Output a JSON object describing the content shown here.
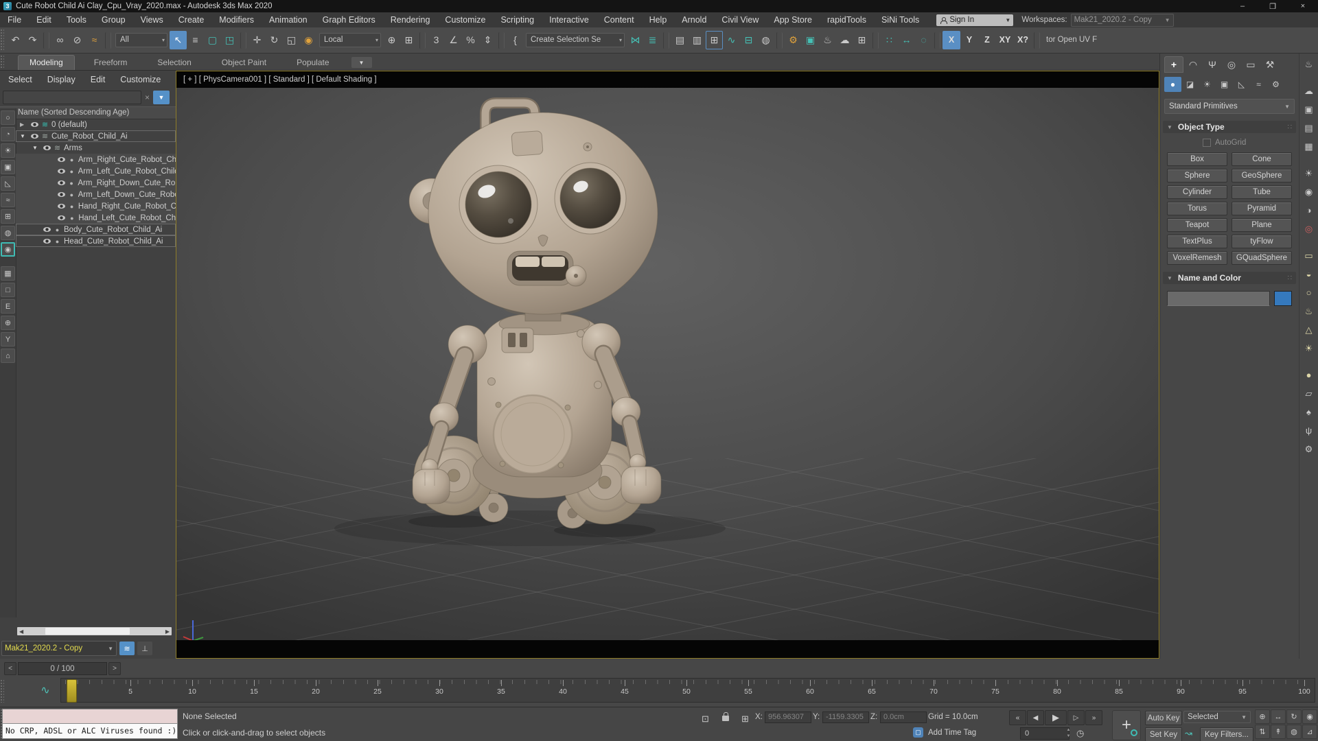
{
  "titlebar": {
    "app_icon": "3",
    "title": "Cute Robot Child Ai Clay_Cpu_Vray_2020.max - Autodesk 3ds Max 2020",
    "minimize": "–",
    "maximize": "❐",
    "close": "×"
  },
  "menubar": {
    "items": [
      "File",
      "Edit",
      "Tools",
      "Group",
      "Views",
      "Create",
      "Modifiers",
      "Animation",
      "Graph Editors",
      "Rendering",
      "Customize",
      "Scripting",
      "Interactive",
      "Content",
      "Help",
      "Arnold",
      "Civil View",
      "App Store",
      "rapidTools",
      "SiNi Tools"
    ],
    "sign_in_label": "Sign In",
    "workspaces_label": "Workspaces:",
    "workspace_value": "Mak21_2020.2  - Copy"
  },
  "toolbar": {
    "items": [
      {
        "name": "undo-icon",
        "glyph": "↶"
      },
      {
        "name": "redo-icon",
        "glyph": "↷"
      },
      {
        "name": "toolbar-separator",
        "cls": "sep"
      },
      {
        "name": "select-and-link-icon",
        "glyph": "∞"
      },
      {
        "name": "unlink-selection-icon",
        "glyph": "⊘"
      },
      {
        "name": "bind-to-space-warp-icon",
        "glyph": "≈",
        "cls": "orange"
      },
      {
        "name": "toolbar-separator",
        "cls": "sep"
      },
      {
        "name": "selection-filter-dropdown",
        "glyph": "All",
        "cls": "dd w52"
      },
      {
        "name": "select-object-icon",
        "glyph": "↖",
        "cls": "active"
      },
      {
        "name": "select-by-name-icon",
        "glyph": "≡"
      },
      {
        "name": "rectangular-selection-region-icon",
        "glyph": "▢",
        "cls": "teal"
      },
      {
        "name": "window-crossing-icon",
        "glyph": "◳",
        "cls": "teal"
      },
      {
        "name": "toolbar-separator",
        "cls": "sep"
      },
      {
        "name": "select-and-move-icon",
        "glyph": "✛"
      },
      {
        "name": "select-and-rotate-icon",
        "glyph": "↻"
      },
      {
        "name": "select-and-scale-icon",
        "glyph": "◱"
      },
      {
        "name": "select-and-place-icon",
        "glyph": "◉",
        "cls": "orange"
      },
      {
        "name": "reference-coordinate-dropdown",
        "glyph": "Local",
        "cls": "dd w66"
      },
      {
        "name": "use-pivot-point-icon",
        "glyph": "⊕"
      },
      {
        "name": "select-and-manipulate-icon",
        "glyph": "⊞"
      },
      {
        "name": "toolbar-separator",
        "cls": "sep"
      },
      {
        "name": "snaps-toggle-icon",
        "glyph": "3"
      },
      {
        "name": "angle-snap-icon",
        "glyph": "∠"
      },
      {
        "name": "percent-snap-icon",
        "glyph": "%"
      },
      {
        "name": "spinner-snap-icon",
        "glyph": "⇕"
      },
      {
        "name": "toolbar-separator",
        "cls": "sep"
      },
      {
        "name": "named-selection-sets-icon",
        "glyph": "{"
      },
      {
        "name": "selection-set-dropdown",
        "glyph": "Create Selection Se",
        "cls": "dd w120"
      },
      {
        "name": "mirror-icon",
        "glyph": "⋈",
        "cls": "teal"
      },
      {
        "name": "align-icon",
        "glyph": "≣",
        "cls": "teal"
      },
      {
        "name": "toolbar-separator",
        "cls": "sep"
      },
      {
        "name": "scene-explorer-toggle-icon",
        "glyph": "▤"
      },
      {
        "name": "layer-explorer-toggle-icon",
        "glyph": "▥"
      },
      {
        "name": "ribbon-toggle-icon",
        "glyph": "⊞",
        "cls": "framed"
      },
      {
        "name": "curve-editor-icon",
        "glyph": "∿",
        "cls": "teal"
      },
      {
        "name": "schematic-view-icon",
        "glyph": "⊟",
        "cls": "teal"
      },
      {
        "name": "material-editor-icon",
        "glyph": "◍"
      },
      {
        "name": "toolbar-separator",
        "cls": "sep"
      },
      {
        "name": "render-setup-icon",
        "glyph": "⚙",
        "cls": "orange"
      },
      {
        "name": "rendered-frame-window-icon",
        "glyph": "▣",
        "cls": "teal"
      },
      {
        "name": "render-production-icon",
        "glyph": "♨"
      },
      {
        "name": "render-in-cloud-icon",
        "glyph": "☁"
      },
      {
        "name": "render-presets-icon",
        "glyph": "⊞"
      },
      {
        "name": "toolbar-separator",
        "cls": "sep"
      },
      {
        "name": "snap-grid-icon",
        "glyph": "∷",
        "cls": "teal"
      },
      {
        "name": "measure-distance-icon",
        "glyph": "↔",
        "cls": "teal"
      },
      {
        "name": "soft-selection-icon",
        "glyph": "◌",
        "cls": "teal"
      },
      {
        "name": "toolbar-separator",
        "cls": "sep"
      },
      {
        "name": "axis-x-button",
        "glyph": "X",
        "cls": "axis active"
      },
      {
        "name": "axis-y-button",
        "glyph": "Y",
        "cls": "axis"
      },
      {
        "name": "axis-z-button",
        "glyph": "Z",
        "cls": "axis"
      },
      {
        "name": "axis-xy-button",
        "glyph": "XY",
        "cls": "axis"
      },
      {
        "name": "axis-xq-button",
        "glyph": "X?",
        "cls": "axis"
      },
      {
        "name": "toolbar-separator",
        "cls": "sep"
      },
      {
        "name": "docked-toolbar-label",
        "glyph": "tor Open UV F",
        "cls": "plain"
      }
    ]
  },
  "ribbon": {
    "tabs": [
      {
        "name": "tab-modeling",
        "label": "Modeling",
        "cls": "active"
      },
      {
        "name": "tab-freeform",
        "label": "Freeform"
      },
      {
        "name": "tab-selection",
        "label": "Selection"
      },
      {
        "name": "tab-object-paint",
        "label": "Object Paint"
      },
      {
        "name": "tab-populate",
        "label": "Populate"
      }
    ]
  },
  "scene_explorer": {
    "menus": [
      "Select",
      "Display",
      "Edit",
      "Customize"
    ],
    "search_value": "",
    "column_header": "Name (Sorted Descending Age)",
    "rows": [
      {
        "name": "tree-row-default-layer",
        "label": "0 (default)",
        "cls": "lvl0 closed layer teal-layer"
      },
      {
        "name": "tree-row-cute-robot-child",
        "label": "Cute_Robot_Child_Ai",
        "cls": "lvl0 open layer boxed"
      },
      {
        "name": "tree-row-arms",
        "label": "Arms",
        "cls": "lvl1 open layer"
      },
      {
        "name": "tree-row-arm-right",
        "label": "Arm_Right_Cute_Robot_Chi",
        "cls": "lvl2 leaf geom shaded"
      },
      {
        "name": "tree-row-arm-left",
        "label": "Arm_Left_Cute_Robot_Child",
        "cls": "lvl2 leaf geom shaded"
      },
      {
        "name": "tree-row-arm-right-down",
        "label": "Arm_Right_Down_Cute_Rob",
        "cls": "lvl2 leaf geom shaded"
      },
      {
        "name": "tree-row-arm-left-down",
        "label": "Arm_Left_Down_Cute_Robo",
        "cls": "lvl2 leaf geom shaded"
      },
      {
        "name": "tree-row-hand-right",
        "label": "Hand_Right_Cute_Robot_Cl",
        "cls": "lvl2 leaf geom shaded"
      },
      {
        "name": "tree-row-hand-left",
        "label": "Hand_Left_Cute_Robot_Chi",
        "cls": "lvl2 leaf geom shaded"
      },
      {
        "name": "tree-row-body",
        "label": "Body_Cute_Robot_Child_Ai",
        "cls": "lvl1 leaf geom boxed"
      },
      {
        "name": "tree-row-head",
        "label": "Head_Cute_Robot_Child_Ai",
        "cls": "lvl1 leaf geom boxed"
      }
    ],
    "left_strip": [
      {
        "name": "filter-selection-sets-icon",
        "glyph": "○"
      },
      {
        "name": "filter-geometry-icon",
        "glyph": "◔"
      },
      {
        "name": "filter-lights-icon",
        "glyph": "☀"
      },
      {
        "name": "filter-cameras-icon",
        "glyph": "▣"
      },
      {
        "name": "filter-helpers-icon",
        "glyph": "◺"
      },
      {
        "name": "filter-space-warps-icon",
        "glyph": "≈"
      },
      {
        "name": "filter-groups-icon",
        "glyph": "⊞"
      },
      {
        "name": "filter-xrefs-icon",
        "glyph": "◍"
      },
      {
        "name": "filter-objects-icon",
        "glyph": "◉",
        "cls": "on"
      },
      {
        "name": "filter-containers-icon",
        "glyph": "▦",
        "cls": "gap"
      },
      {
        "name": "filter-shapes-icon",
        "glyph": "□"
      },
      {
        "name": "filter-external-icon",
        "glyph": "E"
      },
      {
        "name": "filter-bones-icon",
        "glyph": "⊕"
      },
      {
        "name": "filter-y-icon",
        "glyph": "Y"
      },
      {
        "name": "filter-folder-icon",
        "glyph": "⌂"
      }
    ],
    "workspace_value": "Mak21_2020.2  - Copy"
  },
  "viewport": {
    "label": "[ + ] [ PhysCamera001 ] [ Standard ] [ Default Shading ]"
  },
  "command_panel": {
    "tabs": [
      {
        "name": "tab-create-icon",
        "glyph": "+",
        "cls": "active"
      },
      {
        "name": "tab-modify-icon",
        "glyph": "◠"
      },
      {
        "name": "tab-hierarchy-icon",
        "glyph": "Ψ"
      },
      {
        "name": "tab-motion-icon",
        "glyph": "◎"
      },
      {
        "name": "tab-display-icon",
        "glyph": "▭"
      },
      {
        "name": "tab-utilities-icon",
        "glyph": "⚒"
      }
    ],
    "categories": [
      {
        "name": "category-geometry-icon",
        "glyph": "●",
        "cls": "active"
      },
      {
        "name": "category-shapes-icon",
        "glyph": "◪"
      },
      {
        "name": "category-lights-icon",
        "glyph": "☀"
      },
      {
        "name": "category-cameras-icon",
        "glyph": "▣"
      },
      {
        "name": "category-helpers-icon",
        "glyph": "◺"
      },
      {
        "name": "category-space-warps-icon",
        "glyph": "≈"
      },
      {
        "name": "category-systems-icon",
        "glyph": "⚙"
      }
    ],
    "subcategory_dropdown": "Standard Primitives",
    "object_type_title": "Object Type",
    "autogrid_label": "AutoGrid",
    "object_buttons": [
      "Box",
      "Cone",
      "Sphere",
      "GeoSphere",
      "Cylinder",
      "Tube",
      "Torus",
      "Pyramid",
      "Teapot",
      "Plane",
      "TextPlus",
      "tyFlow",
      "VoxelRemesh",
      "GQuadSphere"
    ],
    "name_color_title": "Name and Color"
  },
  "right_strip": {
    "items": [
      {
        "name": "render-production-icon",
        "glyph": "♨"
      },
      {
        "name": "render-in-cloud-icon",
        "glyph": "☁",
        "cls": "gap"
      },
      {
        "name": "rendered-frame-window-icon",
        "glyph": "▣"
      },
      {
        "name": "render-setup-window-icon",
        "glyph": "▤"
      },
      {
        "name": "render-presets-window-icon",
        "glyph": "▦"
      },
      {
        "name": "light-lister-icon",
        "glyph": "☀",
        "cls": "gap"
      },
      {
        "name": "camera-lister-icon",
        "glyph": "◉"
      },
      {
        "name": "environment-icon",
        "glyph": "◑"
      },
      {
        "name": "video-post-icon",
        "glyph": "◎",
        "cls": "red"
      },
      {
        "name": "rect-light-icon",
        "glyph": "▭",
        "cls": "gap light"
      },
      {
        "name": "dome-light-icon",
        "glyph": "◒",
        "cls": "light"
      },
      {
        "name": "disc-light-icon",
        "glyph": "○",
        "cls": "light"
      },
      {
        "name": "wire-teapot-icon",
        "glyph": "♨",
        "cls": "light"
      },
      {
        "name": "cone-primitive-icon",
        "glyph": "△",
        "cls": "light"
      },
      {
        "name": "sun-light-icon",
        "glyph": "☀",
        "cls": "light"
      },
      {
        "name": "sphere-primitive-icon",
        "glyph": "●",
        "cls": "light gap"
      },
      {
        "name": "plane-primitive-icon",
        "glyph": "▱"
      },
      {
        "name": "tree-object-icon",
        "glyph": "♠"
      },
      {
        "name": "grass-object-icon",
        "glyph": "ψ"
      },
      {
        "name": "settings-icon",
        "glyph": "⚙"
      }
    ]
  },
  "trackbar": {
    "frame_indicator": "0 / 100",
    "prev_arrow": "<",
    "next_arrow": ">",
    "labels": [
      "0",
      "5",
      "10",
      "15",
      "20",
      "25",
      "30",
      "35",
      "40",
      "45",
      "50",
      "55",
      "60",
      "65",
      "70",
      "75",
      "80",
      "85",
      "90",
      "95",
      "100"
    ]
  },
  "statusbar": {
    "listener_line2": "No CRP, ADSL or ALC Viruses found :)",
    "selection_status": "None Selected",
    "prompt": "Click or click-and-drag to select objects",
    "x_label": "X:",
    "x_value": "956.96307",
    "y_label": "Y:",
    "y_value": "-1159.3305",
    "z_label": "Z:",
    "z_value": "0.0cm",
    "grid_label": "Grid = 10.0cm",
    "add_time_tag": "Add Time Tag",
    "frame_value": "0",
    "auto_key": "Auto Key",
    "set_key": "Set Key",
    "key_mode": "Selected",
    "key_filters": "Key Filters...",
    "playback": [
      {
        "name": "go-to-start-icon",
        "glyph": "«"
      },
      {
        "name": "previous-frame-icon",
        "glyph": "◀"
      },
      {
        "name": "play-icon",
        "glyph": "▶",
        "cls": "big"
      },
      {
        "name": "next-frame-icon",
        "glyph": "▷"
      },
      {
        "name": "go-to-end-icon",
        "glyph": "»"
      }
    ],
    "viewport_nav": [
      {
        "name": "zoom-icon",
        "glyph": "⊕"
      },
      {
        "name": "pan-icon",
        "glyph": "↔"
      },
      {
        "name": "orbit-icon",
        "glyph": "↻"
      },
      {
        "name": "fov-icon",
        "glyph": "◉"
      },
      {
        "name": "dolly-icon",
        "glyph": "⇅"
      },
      {
        "name": "walk-through-icon",
        "glyph": "↟"
      },
      {
        "name": "orbit-selected-icon",
        "glyph": "◍"
      },
      {
        "name": "maximize-viewport-toggle-icon",
        "glyph": "⊿"
      }
    ]
  }
}
